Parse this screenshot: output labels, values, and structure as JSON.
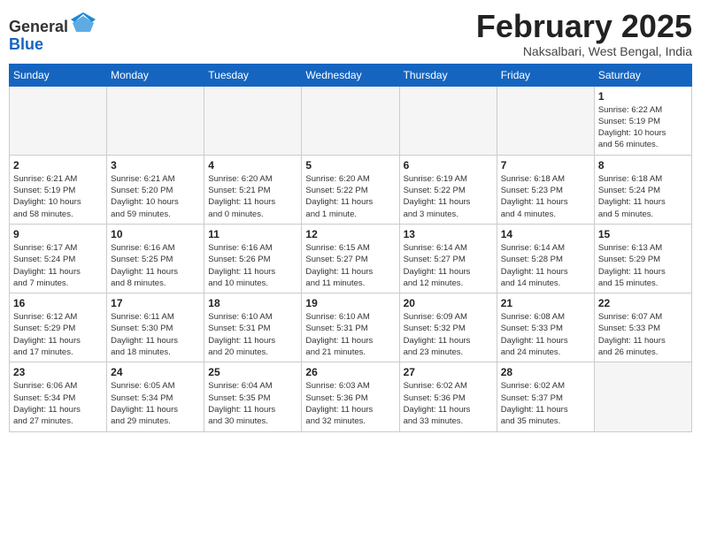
{
  "header": {
    "logo_general": "General",
    "logo_blue": "Blue",
    "month_title": "February 2025",
    "location": "Naksalbari, West Bengal, India"
  },
  "weekdays": [
    "Sunday",
    "Monday",
    "Tuesday",
    "Wednesday",
    "Thursday",
    "Friday",
    "Saturday"
  ],
  "weeks": [
    [
      {
        "day": "",
        "info": ""
      },
      {
        "day": "",
        "info": ""
      },
      {
        "day": "",
        "info": ""
      },
      {
        "day": "",
        "info": ""
      },
      {
        "day": "",
        "info": ""
      },
      {
        "day": "",
        "info": ""
      },
      {
        "day": "1",
        "info": "Sunrise: 6:22 AM\nSunset: 5:19 PM\nDaylight: 10 hours\nand 56 minutes."
      }
    ],
    [
      {
        "day": "2",
        "info": "Sunrise: 6:21 AM\nSunset: 5:19 PM\nDaylight: 10 hours\nand 58 minutes."
      },
      {
        "day": "3",
        "info": "Sunrise: 6:21 AM\nSunset: 5:20 PM\nDaylight: 10 hours\nand 59 minutes."
      },
      {
        "day": "4",
        "info": "Sunrise: 6:20 AM\nSunset: 5:21 PM\nDaylight: 11 hours\nand 0 minutes."
      },
      {
        "day": "5",
        "info": "Sunrise: 6:20 AM\nSunset: 5:22 PM\nDaylight: 11 hours\nand 1 minute."
      },
      {
        "day": "6",
        "info": "Sunrise: 6:19 AM\nSunset: 5:22 PM\nDaylight: 11 hours\nand 3 minutes."
      },
      {
        "day": "7",
        "info": "Sunrise: 6:18 AM\nSunset: 5:23 PM\nDaylight: 11 hours\nand 4 minutes."
      },
      {
        "day": "8",
        "info": "Sunrise: 6:18 AM\nSunset: 5:24 PM\nDaylight: 11 hours\nand 5 minutes."
      }
    ],
    [
      {
        "day": "9",
        "info": "Sunrise: 6:17 AM\nSunset: 5:24 PM\nDaylight: 11 hours\nand 7 minutes."
      },
      {
        "day": "10",
        "info": "Sunrise: 6:16 AM\nSunset: 5:25 PM\nDaylight: 11 hours\nand 8 minutes."
      },
      {
        "day": "11",
        "info": "Sunrise: 6:16 AM\nSunset: 5:26 PM\nDaylight: 11 hours\nand 10 minutes."
      },
      {
        "day": "12",
        "info": "Sunrise: 6:15 AM\nSunset: 5:27 PM\nDaylight: 11 hours\nand 11 minutes."
      },
      {
        "day": "13",
        "info": "Sunrise: 6:14 AM\nSunset: 5:27 PM\nDaylight: 11 hours\nand 12 minutes."
      },
      {
        "day": "14",
        "info": "Sunrise: 6:14 AM\nSunset: 5:28 PM\nDaylight: 11 hours\nand 14 minutes."
      },
      {
        "day": "15",
        "info": "Sunrise: 6:13 AM\nSunset: 5:29 PM\nDaylight: 11 hours\nand 15 minutes."
      }
    ],
    [
      {
        "day": "16",
        "info": "Sunrise: 6:12 AM\nSunset: 5:29 PM\nDaylight: 11 hours\nand 17 minutes."
      },
      {
        "day": "17",
        "info": "Sunrise: 6:11 AM\nSunset: 5:30 PM\nDaylight: 11 hours\nand 18 minutes."
      },
      {
        "day": "18",
        "info": "Sunrise: 6:10 AM\nSunset: 5:31 PM\nDaylight: 11 hours\nand 20 minutes."
      },
      {
        "day": "19",
        "info": "Sunrise: 6:10 AM\nSunset: 5:31 PM\nDaylight: 11 hours\nand 21 minutes."
      },
      {
        "day": "20",
        "info": "Sunrise: 6:09 AM\nSunset: 5:32 PM\nDaylight: 11 hours\nand 23 minutes."
      },
      {
        "day": "21",
        "info": "Sunrise: 6:08 AM\nSunset: 5:33 PM\nDaylight: 11 hours\nand 24 minutes."
      },
      {
        "day": "22",
        "info": "Sunrise: 6:07 AM\nSunset: 5:33 PM\nDaylight: 11 hours\nand 26 minutes."
      }
    ],
    [
      {
        "day": "23",
        "info": "Sunrise: 6:06 AM\nSunset: 5:34 PM\nDaylight: 11 hours\nand 27 minutes."
      },
      {
        "day": "24",
        "info": "Sunrise: 6:05 AM\nSunset: 5:34 PM\nDaylight: 11 hours\nand 29 minutes."
      },
      {
        "day": "25",
        "info": "Sunrise: 6:04 AM\nSunset: 5:35 PM\nDaylight: 11 hours\nand 30 minutes."
      },
      {
        "day": "26",
        "info": "Sunrise: 6:03 AM\nSunset: 5:36 PM\nDaylight: 11 hours\nand 32 minutes."
      },
      {
        "day": "27",
        "info": "Sunrise: 6:02 AM\nSunset: 5:36 PM\nDaylight: 11 hours\nand 33 minutes."
      },
      {
        "day": "28",
        "info": "Sunrise: 6:02 AM\nSunset: 5:37 PM\nDaylight: 11 hours\nand 35 minutes."
      },
      {
        "day": "",
        "info": ""
      }
    ]
  ]
}
